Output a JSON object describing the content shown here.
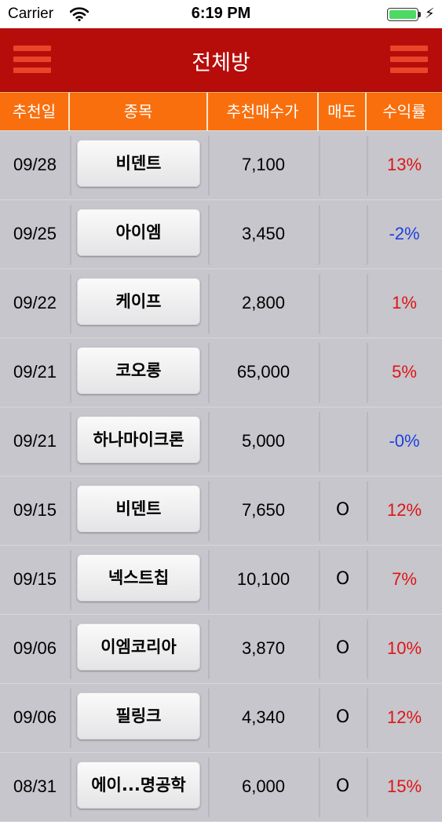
{
  "status_bar": {
    "carrier": "Carrier",
    "time": "6:19 PM",
    "battery_level": 1.0,
    "battery_color": "#4cd964"
  },
  "navbar": {
    "title": "전체방",
    "left_icon": "hamburger-menu-icon",
    "right_icon": "hamburger-menu-icon",
    "background": "#b70d0a"
  },
  "table": {
    "header_color": "#f96f0d",
    "columns": [
      "추천일",
      "종목",
      "추천매수가",
      "매도",
      "수익률"
    ],
    "rows": [
      {
        "date": "09/28",
        "stock": "비덴트",
        "price": "7,100",
        "sold": "",
        "return": "13%",
        "trend": "pos"
      },
      {
        "date": "09/25",
        "stock": "아이엠",
        "price": "3,450",
        "sold": "",
        "return": "-2%",
        "trend": "neg"
      },
      {
        "date": "09/22",
        "stock": "케이프",
        "price": "2,800",
        "sold": "",
        "return": "1%",
        "trend": "pos"
      },
      {
        "date": "09/21",
        "stock": "코오롱",
        "price": "65,000",
        "sold": "",
        "return": "5%",
        "trend": "pos"
      },
      {
        "date": "09/21",
        "stock": "하나마이크론",
        "price": "5,000",
        "sold": "",
        "return": "-0%",
        "trend": "neg"
      },
      {
        "date": "09/15",
        "stock": "비덴트",
        "price": "7,650",
        "sold": "O",
        "return": "12%",
        "trend": "pos"
      },
      {
        "date": "09/15",
        "stock": "넥스트칩",
        "price": "10,100",
        "sold": "O",
        "return": "7%",
        "trend": "pos"
      },
      {
        "date": "09/06",
        "stock": "이엠코리아",
        "price": "3,870",
        "sold": "O",
        "return": "10%",
        "trend": "pos"
      },
      {
        "date": "09/06",
        "stock": "필링크",
        "price": "4,340",
        "sold": "O",
        "return": "12%",
        "trend": "pos"
      },
      {
        "date": "08/31",
        "stock": "에이...명공학",
        "price": "6,000",
        "sold": "O",
        "return": "15%",
        "trend": "pos"
      }
    ]
  },
  "colors": {
    "positive": "#e01414",
    "negative": "#1f3fe0"
  }
}
